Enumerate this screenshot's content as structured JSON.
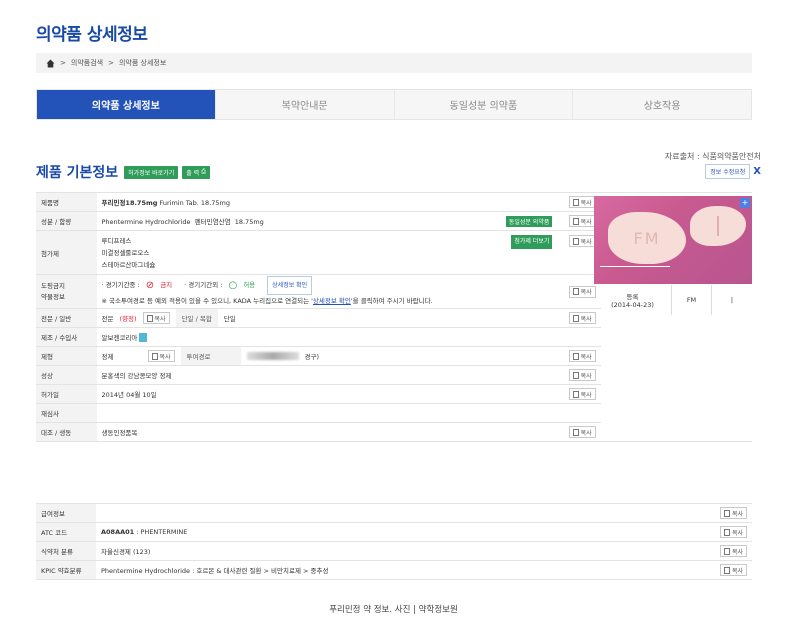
{
  "page": {
    "title": "의약품 상세정보",
    "caption": "푸리민정 약 정보. 사진 | 약학정보원"
  },
  "breadcrumb": {
    "sep": ">",
    "item1": "의약품검색",
    "item2": "의약품 상세정보"
  },
  "tabs": [
    {
      "label": "의약품 상세정보",
      "active": true
    },
    {
      "label": "복약안내문"
    },
    {
      "label": "동일성분 의약품"
    },
    {
      "label": "상호작용"
    }
  ],
  "section": {
    "title": "제품 기본정보",
    "btn1": "허가정보 바로가기",
    "btn2": "출 력",
    "source": "자료출처 : 식품의약품안전처",
    "request": "정보 수정요청",
    "close": "X"
  },
  "copy_label": "복사",
  "rows": {
    "product": {
      "label": "제품명",
      "name": "푸리민정18.75mg",
      "en": "Furimin Tab. 18.75mg"
    },
    "ingredient": {
      "label": "성분 / 함량",
      "en": "Phentermine Hydrochloride",
      "ko": "펜터민염산염",
      "amount": "18.75mg",
      "same_btn": "동일성분 의약품"
    },
    "additive": {
      "label": "첨가제",
      "items": [
        "루디프레스",
        "미결정셀룰로오스",
        "스테아르산마그네슘"
      ],
      "more_btn": "첨가제 더보기"
    },
    "dur": {
      "label1": "도핑금지",
      "label2": "약물정보",
      "in_comp": "· 경기기간중 :",
      "prohibited": "금지",
      "out_comp": "· 경기기간외 :",
      "allowed": "허용",
      "detail_btn": "상세정보 확인",
      "note_pre": "※ 국소투여경로 등 예외 적용이 있을 수 있으니, KADA 누리집으로 연결되는 '",
      "note_link": "상세정보 확인",
      "note_post": "'을 클릭하여 주시기 바랍니다."
    },
    "specialty": {
      "label": "전문 / 일반",
      "value": "전문",
      "tag": "(향정)",
      "combo_label": "단일 / 복합",
      "combo_value": "단일"
    },
    "maker": {
      "label": "제조 / 수입사",
      "value": "알보젠코리아"
    },
    "form": {
      "label": "제형",
      "value": "정제",
      "route_label": "투여경로",
      "route_value": "경구)"
    },
    "shape": {
      "label": "성상",
      "value": "분홍색의 강남콩모양 정제"
    },
    "approval": {
      "label": "허가일",
      "value": "2014년 04월 10일"
    },
    "reexam": {
      "label": "재심사",
      "value": ""
    },
    "bioequiv": {
      "label": "대조 / 생동",
      "value": "생동인정품목"
    },
    "insurance": {
      "label": "급여정보",
      "value": ""
    },
    "atc": {
      "label": "ATC 코드",
      "code": "A08AA01",
      "name": " : PHENTERMINE"
    },
    "mfds": {
      "label": "식약처 분류",
      "value": "자율신경제 (123)"
    },
    "kpic": {
      "label": "KPIC 약효분류",
      "value": "Phentermine Hydrochloride : 호르몬 & 대사관련 질환 > 비만치료제 > 중추성"
    }
  },
  "image": {
    "mark_front": "FM",
    "status": "등록",
    "date": "(2014-04-23)",
    "mark_code": "FM",
    "mark_back": "|"
  },
  "colors": {
    "accent": "#2352b8",
    "green": "#2f9c5a",
    "red": "#d23"
  }
}
